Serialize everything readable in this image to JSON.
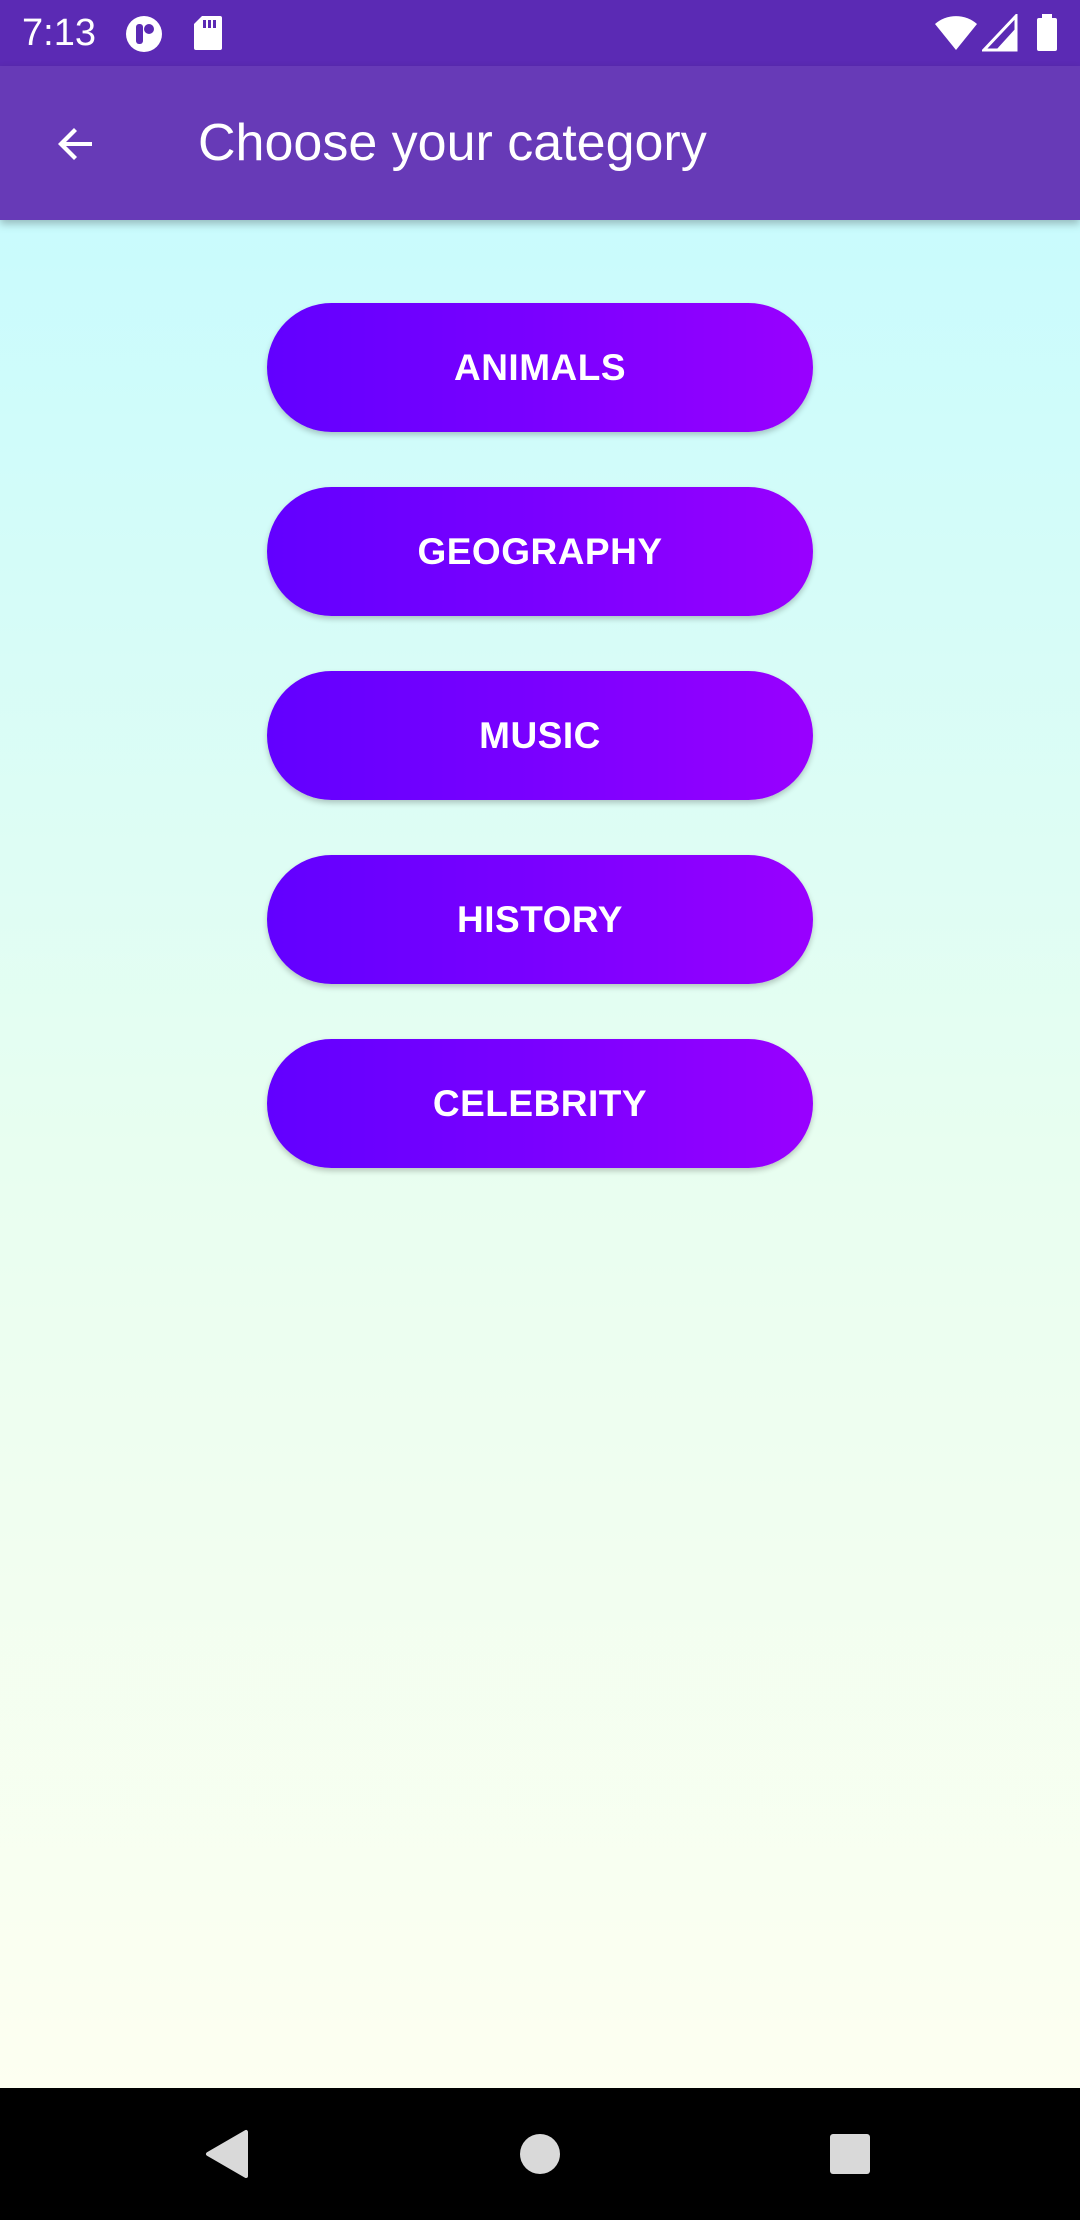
{
  "status_bar": {
    "time": "7:13",
    "icons": [
      "app-notification-icon",
      "sd-card-icon",
      "wifi-icon",
      "cellular-signal-icon",
      "battery-icon"
    ]
  },
  "app_bar": {
    "title": "Choose your category",
    "back_icon": "arrow-back-icon"
  },
  "categories": [
    {
      "label": "ANIMALS"
    },
    {
      "label": "GEOGRAPHY"
    },
    {
      "label": "MUSIC"
    },
    {
      "label": "HISTORY"
    },
    {
      "label": "CELEBRITY"
    }
  ],
  "nav_bar": {
    "icons": [
      "back-triangle-icon",
      "home-circle-icon",
      "recents-square-icon"
    ]
  },
  "colors": {
    "status_bar": "#5b2ab4",
    "app_bar": "#673ab7",
    "button_start": "#6200ff",
    "button_end": "#9900ff",
    "background_top": "#c9fbfd",
    "background_bottom": "#fdfff1"
  }
}
